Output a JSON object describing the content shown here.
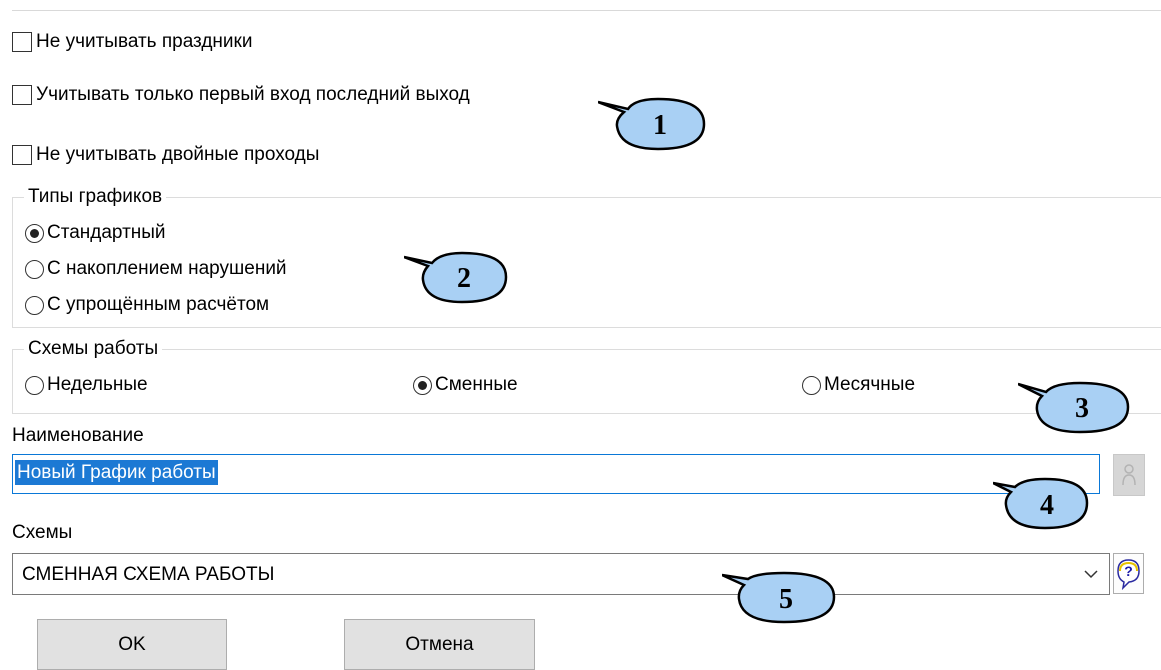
{
  "options": {
    "no_holidays": "Не учитывать праздники",
    "first_last_only": "Учитывать только первый вход последний выход",
    "no_double_pass": "Не учитывать двойные проходы"
  },
  "schedule_types": {
    "legend": "Типы графиков",
    "standard": "Стандартный",
    "accumulation": "С накоплением нарушений",
    "simplified": "С упрощённым расчётом",
    "selected": "Стандартный"
  },
  "work_schemes": {
    "legend": "Схемы работы",
    "weekly": "Недельные",
    "shift": "Сменные",
    "monthly": "Месячные",
    "selected": "Сменные"
  },
  "name": {
    "label": "Наименование",
    "value": "Новый График работы"
  },
  "schemes": {
    "label": "Схемы",
    "value": "СМЕННАЯ СХЕМА РАБОТЫ"
  },
  "buttons": {
    "ok": "OK",
    "cancel": "Отмена"
  },
  "callouts": [
    "1",
    "2",
    "3",
    "4",
    "5"
  ],
  "colors": {
    "callout_fill": "#a9d0f4",
    "selection": "#1c79d4",
    "focus_border": "#0a78d7",
    "button_face": "#e1e1e1"
  }
}
